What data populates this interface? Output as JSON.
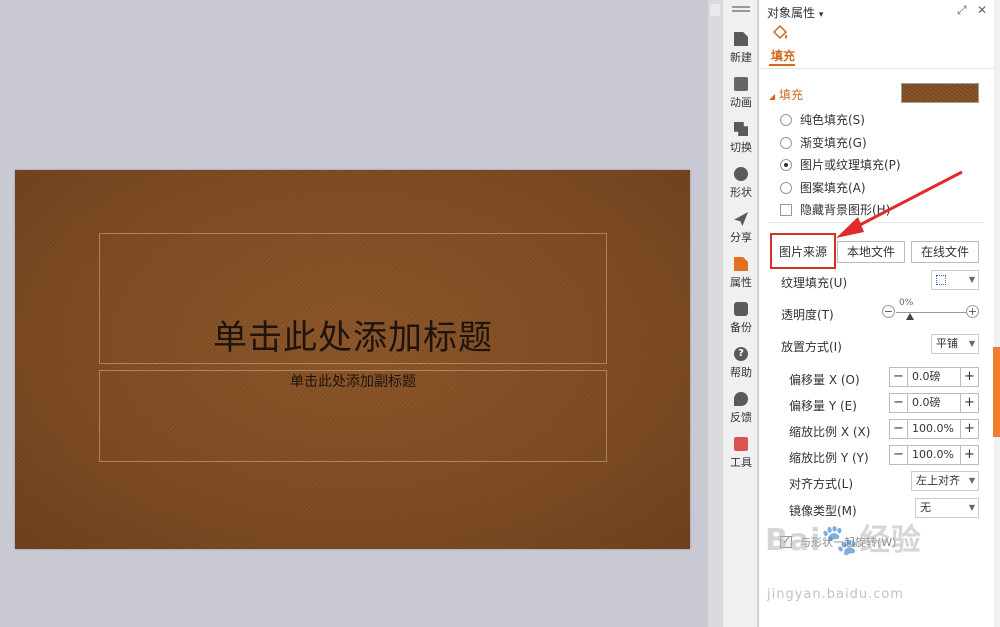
{
  "slide": {
    "title_placeholder": "单击此处添加标题",
    "subtitle_placeholder": "单击此处添加副标题"
  },
  "sidebar": {
    "items": [
      {
        "label": "新建",
        "icon": "new-doc-icon"
      },
      {
        "label": "动画",
        "icon": "animation-icon"
      },
      {
        "label": "切换",
        "icon": "transition-icon"
      },
      {
        "label": "形状",
        "icon": "shape-icon"
      },
      {
        "label": "分享",
        "icon": "share-icon"
      },
      {
        "label": "属性",
        "icon": "properties-icon",
        "active": true
      },
      {
        "label": "备份",
        "icon": "backup-icon"
      },
      {
        "label": "帮助",
        "icon": "help-icon"
      },
      {
        "label": "反馈",
        "icon": "feedback-icon"
      },
      {
        "label": "工具",
        "icon": "tools-icon"
      }
    ]
  },
  "panel": {
    "title": "对象属性",
    "title_arrow": "▾",
    "tab_label": "填充",
    "section_header": "填充",
    "fill_options": [
      {
        "label": "纯色填充(S)",
        "checked": false
      },
      {
        "label": "渐变填充(G)",
        "checked": false
      },
      {
        "label": "图片或纹理填充(P)",
        "checked": true
      },
      {
        "label": "图案填充(A)",
        "checked": false
      }
    ],
    "hide_background_label": "隐藏背景图形(H)",
    "picture_source_label": "图片来源",
    "local_file_button": "本地文件",
    "online_file_button": "在线文件",
    "texture_fill_label": "纹理填充(U)",
    "transparency_label": "透明度(T)",
    "transparency_value": "0%",
    "placement_label": "放置方式(I)",
    "placement_value": "平铺",
    "offset_x_label": "偏移量 X (O)",
    "offset_x_value": "0.0磅",
    "offset_y_label": "偏移量 Y (E)",
    "offset_y_value": "0.0磅",
    "scale_x_label": "缩放比例 X (X)",
    "scale_x_value": "100.0%",
    "scale_y_label": "缩放比例 Y (Y)",
    "scale_y_value": "100.0%",
    "align_label": "对齐方式(L)",
    "align_value": "左上对齐",
    "mirror_label": "镜像类型(M)",
    "mirror_value": "无",
    "rotate_with_shape_label": "与形状一起旋转(W)"
  },
  "watermark": {
    "logo_text": "Bai🐾经验",
    "url": "jingyan.baidu.com"
  },
  "colors": {
    "accent": "#d2691e",
    "highlight_box": "#d93025",
    "slide_texture": "#7b4a22"
  }
}
